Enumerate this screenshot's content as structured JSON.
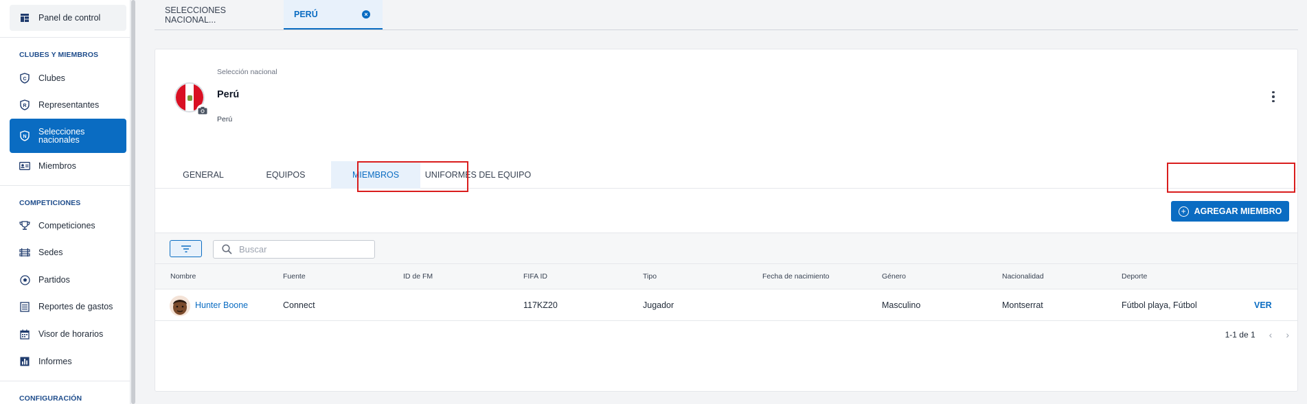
{
  "sidebar": {
    "top_item": {
      "label": "Panel de control",
      "icon": "dashboard-icon"
    },
    "sections": [
      {
        "title": "CLUBES Y MIEMBROS"
      },
      {
        "title": "COMPETICIONES"
      },
      {
        "title": "CONFIGURACIÓN"
      }
    ],
    "items": [
      {
        "label": "Clubes",
        "icon": "club-shield-icon"
      },
      {
        "label": "Representantes",
        "icon": "representative-shield-icon"
      },
      {
        "label": "Selecciones nacionales",
        "icon": "national-shield-icon"
      },
      {
        "label": "Miembros",
        "icon": "id-card-icon"
      },
      {
        "label": "Competiciones",
        "icon": "trophy-icon"
      },
      {
        "label": "Sedes",
        "icon": "stadium-icon"
      },
      {
        "label": "Partidos",
        "icon": "ball-icon"
      },
      {
        "label": "Reportes de gastos",
        "icon": "report-icon"
      },
      {
        "label": "Visor de horarios",
        "icon": "calendar-icon"
      },
      {
        "label": "Informes",
        "icon": "chart-icon"
      }
    ]
  },
  "top_tabs": [
    {
      "label": "SELECCIONES NACIONAL..."
    },
    {
      "label": "PERÚ"
    }
  ],
  "profile": {
    "kicker": "Selección nacional",
    "name": "Perú",
    "country": "Perú"
  },
  "tabs": [
    {
      "label": "GENERAL"
    },
    {
      "label": "EQUIPOS"
    },
    {
      "label": "MIEMBROS"
    },
    {
      "label": "UNIFORMES DEL EQUIPO"
    }
  ],
  "add_button": {
    "label": "AGREGAR MIEMBRO"
  },
  "search": {
    "placeholder": "Buscar"
  },
  "table": {
    "columns": [
      "Nombre",
      "Fuente",
      "ID de FM",
      "FIFA ID",
      "Tipo",
      "Fecha de nacimiento",
      "Género",
      "Nacionalidad",
      "Deporte"
    ],
    "rows": [
      {
        "name": "Hunter Boone",
        "source": "Connect",
        "fm_id": "",
        "fifa_id": "117KZ20",
        "type": "Jugador",
        "birth_date": "",
        "gender": "Masculino",
        "nationality": "Montserrat",
        "sport": "Fútbol playa, Fútbol",
        "action": "VER"
      }
    ]
  },
  "pagination": {
    "range": "1-1 de 1"
  },
  "colors": {
    "primary": "#0a6cc2",
    "highlight": "#d91c1c"
  }
}
